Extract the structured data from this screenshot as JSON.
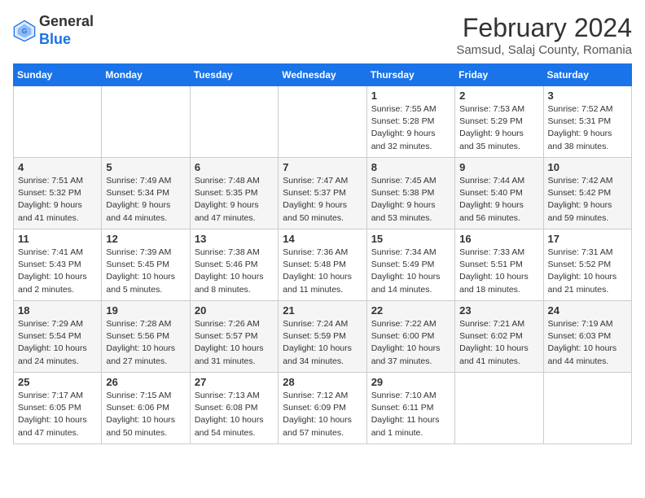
{
  "header": {
    "logo_line1": "General",
    "logo_line2": "Blue",
    "title": "February 2024",
    "subtitle": "Samsud, Salaj County, Romania"
  },
  "weekdays": [
    "Sunday",
    "Monday",
    "Tuesday",
    "Wednesday",
    "Thursday",
    "Friday",
    "Saturday"
  ],
  "weeks": [
    [
      {
        "day": "",
        "info": ""
      },
      {
        "day": "",
        "info": ""
      },
      {
        "day": "",
        "info": ""
      },
      {
        "day": "",
        "info": ""
      },
      {
        "day": "1",
        "info": "Sunrise: 7:55 AM\nSunset: 5:28 PM\nDaylight: 9 hours\nand 32 minutes."
      },
      {
        "day": "2",
        "info": "Sunrise: 7:53 AM\nSunset: 5:29 PM\nDaylight: 9 hours\nand 35 minutes."
      },
      {
        "day": "3",
        "info": "Sunrise: 7:52 AM\nSunset: 5:31 PM\nDaylight: 9 hours\nand 38 minutes."
      }
    ],
    [
      {
        "day": "4",
        "info": "Sunrise: 7:51 AM\nSunset: 5:32 PM\nDaylight: 9 hours\nand 41 minutes."
      },
      {
        "day": "5",
        "info": "Sunrise: 7:49 AM\nSunset: 5:34 PM\nDaylight: 9 hours\nand 44 minutes."
      },
      {
        "day": "6",
        "info": "Sunrise: 7:48 AM\nSunset: 5:35 PM\nDaylight: 9 hours\nand 47 minutes."
      },
      {
        "day": "7",
        "info": "Sunrise: 7:47 AM\nSunset: 5:37 PM\nDaylight: 9 hours\nand 50 minutes."
      },
      {
        "day": "8",
        "info": "Sunrise: 7:45 AM\nSunset: 5:38 PM\nDaylight: 9 hours\nand 53 minutes."
      },
      {
        "day": "9",
        "info": "Sunrise: 7:44 AM\nSunset: 5:40 PM\nDaylight: 9 hours\nand 56 minutes."
      },
      {
        "day": "10",
        "info": "Sunrise: 7:42 AM\nSunset: 5:42 PM\nDaylight: 9 hours\nand 59 minutes."
      }
    ],
    [
      {
        "day": "11",
        "info": "Sunrise: 7:41 AM\nSunset: 5:43 PM\nDaylight: 10 hours\nand 2 minutes."
      },
      {
        "day": "12",
        "info": "Sunrise: 7:39 AM\nSunset: 5:45 PM\nDaylight: 10 hours\nand 5 minutes."
      },
      {
        "day": "13",
        "info": "Sunrise: 7:38 AM\nSunset: 5:46 PM\nDaylight: 10 hours\nand 8 minutes."
      },
      {
        "day": "14",
        "info": "Sunrise: 7:36 AM\nSunset: 5:48 PM\nDaylight: 10 hours\nand 11 minutes."
      },
      {
        "day": "15",
        "info": "Sunrise: 7:34 AM\nSunset: 5:49 PM\nDaylight: 10 hours\nand 14 minutes."
      },
      {
        "day": "16",
        "info": "Sunrise: 7:33 AM\nSunset: 5:51 PM\nDaylight: 10 hours\nand 18 minutes."
      },
      {
        "day": "17",
        "info": "Sunrise: 7:31 AM\nSunset: 5:52 PM\nDaylight: 10 hours\nand 21 minutes."
      }
    ],
    [
      {
        "day": "18",
        "info": "Sunrise: 7:29 AM\nSunset: 5:54 PM\nDaylight: 10 hours\nand 24 minutes."
      },
      {
        "day": "19",
        "info": "Sunrise: 7:28 AM\nSunset: 5:56 PM\nDaylight: 10 hours\nand 27 minutes."
      },
      {
        "day": "20",
        "info": "Sunrise: 7:26 AM\nSunset: 5:57 PM\nDaylight: 10 hours\nand 31 minutes."
      },
      {
        "day": "21",
        "info": "Sunrise: 7:24 AM\nSunset: 5:59 PM\nDaylight: 10 hours\nand 34 minutes."
      },
      {
        "day": "22",
        "info": "Sunrise: 7:22 AM\nSunset: 6:00 PM\nDaylight: 10 hours\nand 37 minutes."
      },
      {
        "day": "23",
        "info": "Sunrise: 7:21 AM\nSunset: 6:02 PM\nDaylight: 10 hours\nand 41 minutes."
      },
      {
        "day": "24",
        "info": "Sunrise: 7:19 AM\nSunset: 6:03 PM\nDaylight: 10 hours\nand 44 minutes."
      }
    ],
    [
      {
        "day": "25",
        "info": "Sunrise: 7:17 AM\nSunset: 6:05 PM\nDaylight: 10 hours\nand 47 minutes."
      },
      {
        "day": "26",
        "info": "Sunrise: 7:15 AM\nSunset: 6:06 PM\nDaylight: 10 hours\nand 50 minutes."
      },
      {
        "day": "27",
        "info": "Sunrise: 7:13 AM\nSunset: 6:08 PM\nDaylight: 10 hours\nand 54 minutes."
      },
      {
        "day": "28",
        "info": "Sunrise: 7:12 AM\nSunset: 6:09 PM\nDaylight: 10 hours\nand 57 minutes."
      },
      {
        "day": "29",
        "info": "Sunrise: 7:10 AM\nSunset: 6:11 PM\nDaylight: 11 hours\nand 1 minute."
      },
      {
        "day": "",
        "info": ""
      },
      {
        "day": "",
        "info": ""
      }
    ]
  ]
}
